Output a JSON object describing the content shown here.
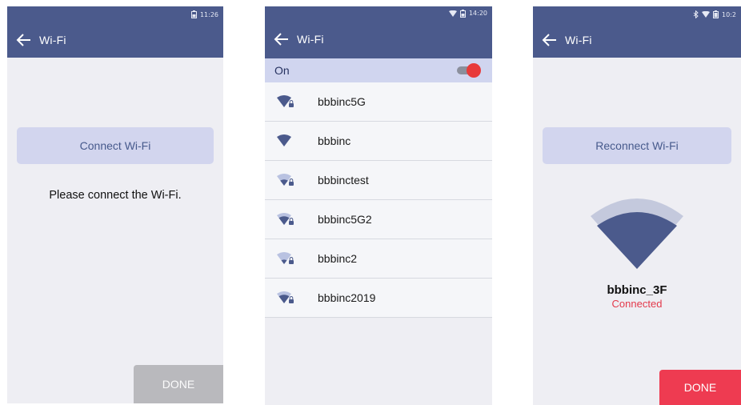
{
  "screens": {
    "left": {
      "time": "11:26",
      "title": "Wi-Fi",
      "button_label": "Connect Wi-Fi",
      "message": "Please connect the Wi-Fi.",
      "done_label": "DONE"
    },
    "middle": {
      "time": "14:20",
      "title": "Wi-Fi",
      "toggle_label": "On",
      "toggle_on": true,
      "networks": [
        {
          "ssid": "bbbinc5G",
          "icon": "wifi-locked-icon"
        },
        {
          "ssid": "bbbinc",
          "icon": "wifi-full-icon"
        },
        {
          "ssid": "bbbinctest",
          "icon": "wifi-locked-icon"
        },
        {
          "ssid": "bbbinc5G2",
          "icon": "wifi-locked-icon"
        },
        {
          "ssid": "bbbinc2",
          "icon": "wifi-locked-icon"
        },
        {
          "ssid": "bbbinc2019",
          "icon": "wifi-locked-icon"
        }
      ]
    },
    "right": {
      "time": "10:2",
      "title": "Wi-Fi",
      "button_label": "Reconnect Wi-Fi",
      "ssid": "bbbinc_3F",
      "status": "Connected",
      "done_label": "DONE"
    }
  },
  "colors": {
    "appbar": "#4b5a8c",
    "button_bg": "#d2d5ee",
    "accent_red": "#ee3b51",
    "done_disabled": "#b9b9bd"
  }
}
